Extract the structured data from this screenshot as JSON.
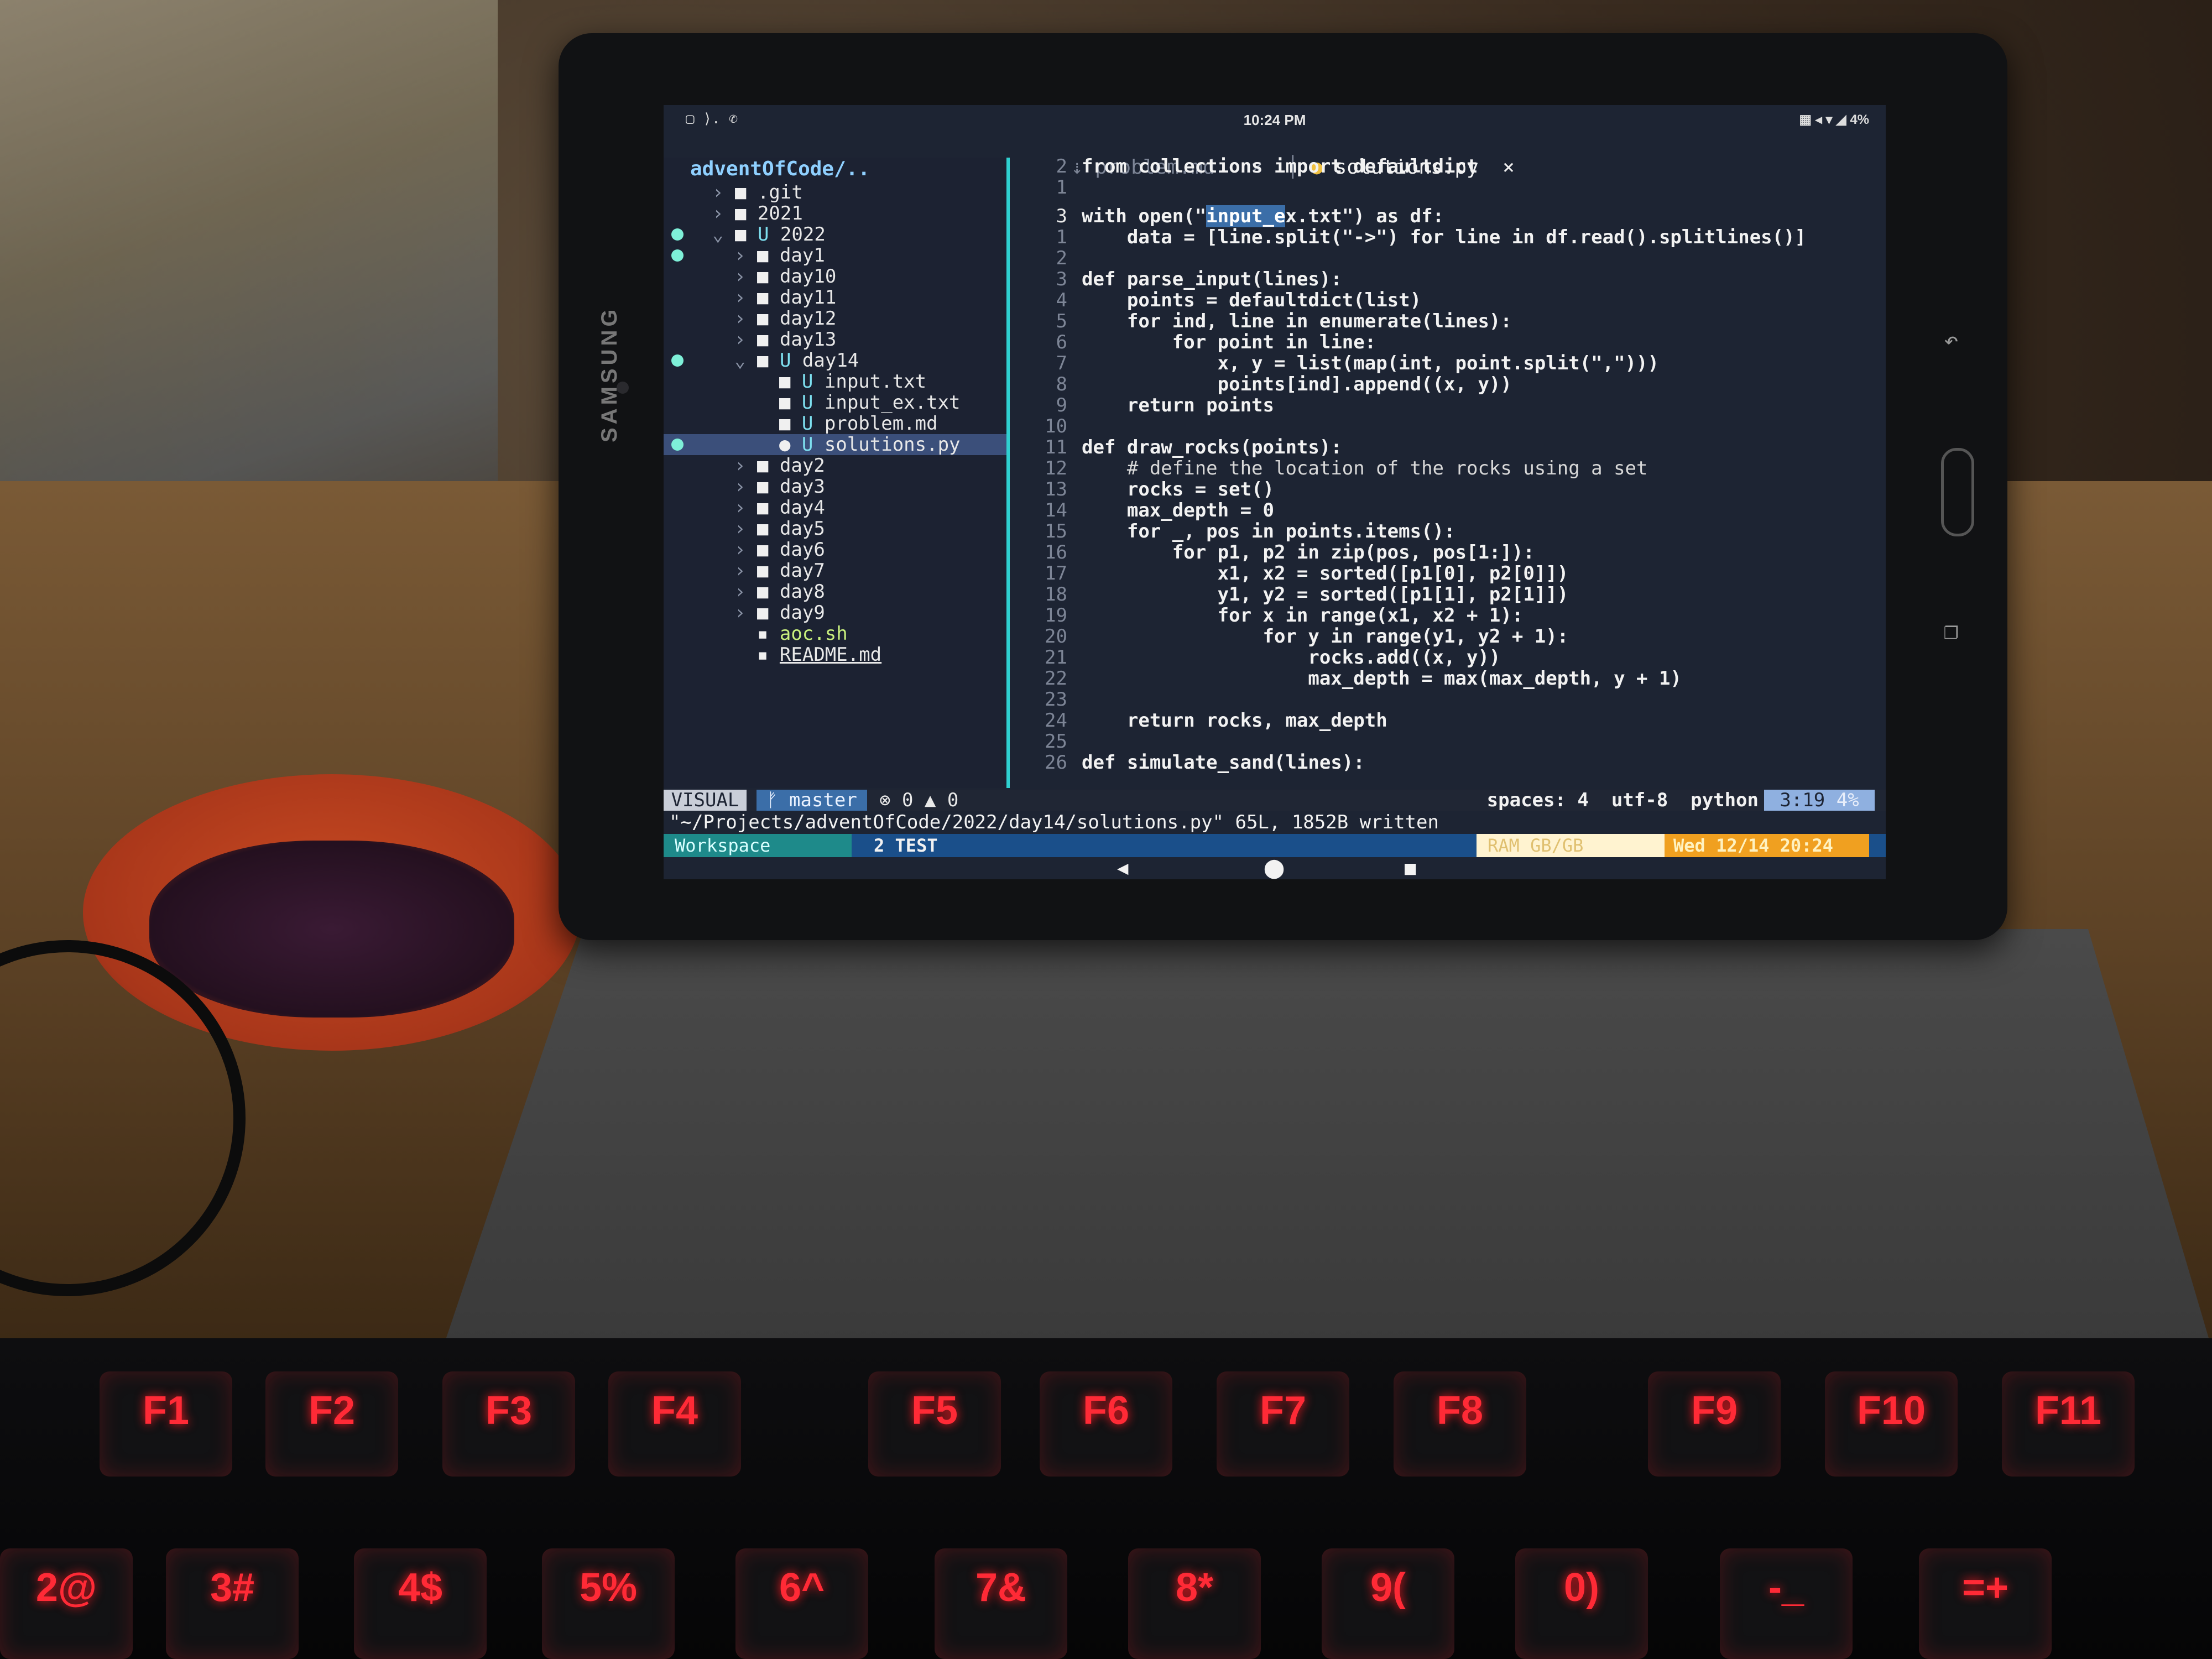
{
  "status_bar": {
    "time": "10:24 PM",
    "battery": "4%",
    "left_icons": "▢ ⟩. ✆",
    "right_icons": "▦ ◂ ▾ ◢"
  },
  "tabs": [
    {
      "label": "problem.md",
      "close": "×",
      "active": false
    },
    {
      "label": "solutions.py",
      "close": "×",
      "active": true
    }
  ],
  "tree": {
    "root": "adventOfCode/..",
    "rows": [
      {
        "arrow": "›",
        "icon": "■",
        "git": "",
        "name": ".git"
      },
      {
        "arrow": "›",
        "icon": "■",
        "git": "",
        "name": "2021"
      },
      {
        "arrow": "⌄",
        "icon": "■",
        "git": "U",
        "name": "2022"
      },
      {
        "arrow": "›",
        "icon": "■",
        "git": "",
        "name": "day1"
      },
      {
        "arrow": "›",
        "icon": "■",
        "git": "",
        "name": "day10"
      },
      {
        "arrow": "›",
        "icon": "■",
        "git": "",
        "name": "day11"
      },
      {
        "arrow": "›",
        "icon": "■",
        "git": "",
        "name": "day12"
      },
      {
        "arrow": "›",
        "icon": "■",
        "git": "",
        "name": "day13"
      },
      {
        "arrow": "⌄",
        "icon": "■",
        "git": "U",
        "name": "day14"
      },
      {
        "arrow": "",
        "icon": "■",
        "git": "U",
        "name": "input.txt"
      },
      {
        "arrow": "",
        "icon": "■",
        "git": "U",
        "name": "input_ex.txt"
      },
      {
        "arrow": "",
        "icon": "■",
        "git": "U",
        "name": "problem.md"
      },
      {
        "arrow": "",
        "icon": "●",
        "git": "U",
        "name": "solutions.py"
      },
      {
        "arrow": "›",
        "icon": "■",
        "git": "",
        "name": "day2"
      },
      {
        "arrow": "›",
        "icon": "■",
        "git": "",
        "name": "day3"
      },
      {
        "arrow": "›",
        "icon": "■",
        "git": "",
        "name": "day4"
      },
      {
        "arrow": "›",
        "icon": "■",
        "git": "",
        "name": "day5"
      },
      {
        "arrow": "›",
        "icon": "■",
        "git": "",
        "name": "day6"
      },
      {
        "arrow": "›",
        "icon": "■",
        "git": "",
        "name": "day7"
      },
      {
        "arrow": "›",
        "icon": "■",
        "git": "",
        "name": "day8"
      },
      {
        "arrow": "›",
        "icon": "■",
        "git": "",
        "name": "day9"
      },
      {
        "arrow": "",
        "icon": "▪",
        "git": "",
        "name": "aoc.sh"
      },
      {
        "arrow": "",
        "icon": "▪",
        "git": "",
        "name": "README.md"
      }
    ]
  },
  "code": [
    {
      "ln": "2",
      "text": "from collections import defaultdict"
    },
    {
      "ln": "1",
      "text": ""
    },
    {
      "ln": "3",
      "text": "with open(\"input_ex.txt\") as df:"
    },
    {
      "ln": "1",
      "text": "    data = [line.split(\"->\") for line in df.read().splitlines()]"
    },
    {
      "ln": "2",
      "text": ""
    },
    {
      "ln": "3",
      "text": "def parse_input(lines):"
    },
    {
      "ln": "4",
      "text": "    points = defaultdict(list)"
    },
    {
      "ln": "5",
      "text": "    for ind, line in enumerate(lines):"
    },
    {
      "ln": "6",
      "text": "        for point in line:"
    },
    {
      "ln": "7",
      "text": "            x, y = list(map(int, point.split(\",\")))"
    },
    {
      "ln": "8",
      "text": "            points[ind].append((x, y))"
    },
    {
      "ln": "9",
      "text": "    return points"
    },
    {
      "ln": "10",
      "text": ""
    },
    {
      "ln": "11",
      "text": "def draw_rocks(points):"
    },
    {
      "ln": "12",
      "text": "    # define the location of the rocks using a set"
    },
    {
      "ln": "13",
      "text": "    rocks = set()"
    },
    {
      "ln": "14",
      "text": "    max_depth = 0"
    },
    {
      "ln": "15",
      "text": "    for _, pos in points.items():"
    },
    {
      "ln": "16",
      "text": "        for p1, p2 in zip(pos, pos[1:]):"
    },
    {
      "ln": "17",
      "text": "            x1, x2 = sorted([p1[0], p2[0]])"
    },
    {
      "ln": "18",
      "text": "            y1, y2 = sorted([p1[1], p2[1]])"
    },
    {
      "ln": "19",
      "text": "            for x in range(x1, x2 + 1):"
    },
    {
      "ln": "20",
      "text": "                for y in range(y1, y2 + 1):"
    },
    {
      "ln": "21",
      "text": "                    rocks.add((x, y))"
    },
    {
      "ln": "22",
      "text": "                    max_depth = max(max_depth, y + 1)"
    },
    {
      "ln": "23",
      "text": ""
    },
    {
      "ln": "24",
      "text": "    return rocks, max_depth"
    },
    {
      "ln": "25",
      "text": ""
    },
    {
      "ln": "26",
      "text": "def simulate_sand(lines):"
    }
  ],
  "statusline": {
    "mode": "VISUAL",
    "branch": "ᚠ master",
    "diagnostics": "⊗ 0 ▲ 0",
    "spaces": "spaces: 4",
    "encoding": "utf-8",
    "filetype": "python",
    "position": "3:19",
    "percent": "4%"
  },
  "message": "\"~/Projects/adventOfCode/2022/day14/solutions.py\" 65L, 1852B written",
  "tmux": {
    "workspace": "Workspace",
    "window": "2 TEST",
    "ram": "RAM GB/GB",
    "date": "Wed 12/14 20:24"
  },
  "device": {
    "brand": "SAMSUNG"
  },
  "keyboard": {
    "fkeys": [
      "F1",
      "F2",
      "F3",
      "F4",
      "F5",
      "F6",
      "F7",
      "F8",
      "F9",
      "F10",
      "F11"
    ],
    "numkeys": [
      "2@",
      "3#",
      "4$",
      "5%",
      "6^",
      "7&",
      "8*",
      "9(",
      "0)",
      "-_",
      "=+"
    ]
  }
}
